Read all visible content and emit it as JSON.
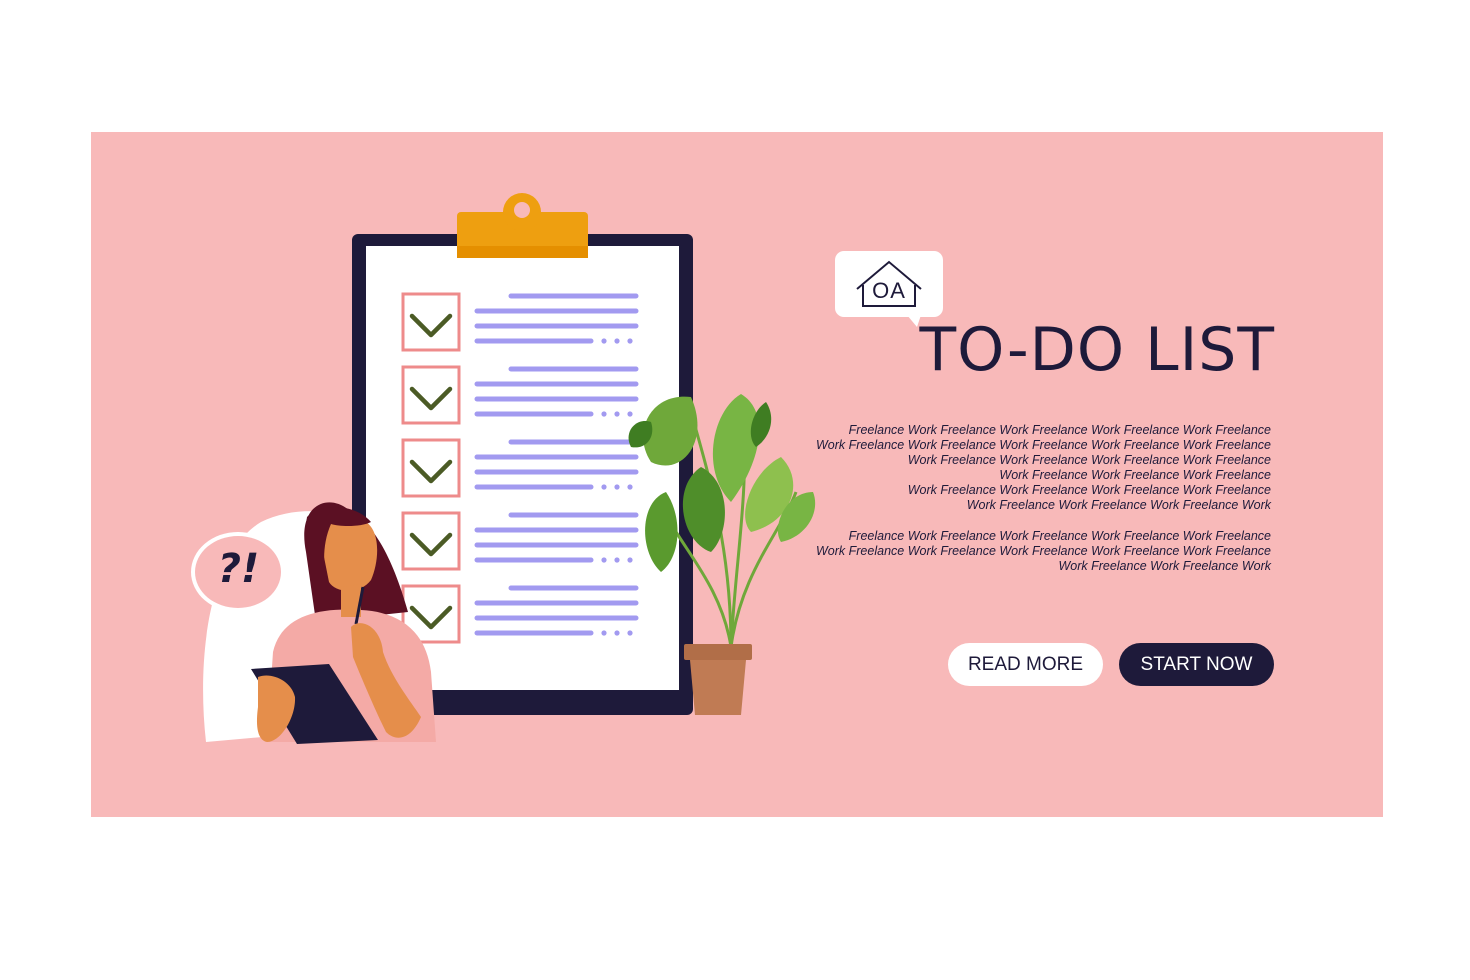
{
  "hero": {
    "logo_text": "OA",
    "title": "TO-DO LIST",
    "paragraph_1": [
      "Freelance Work Freelance Work Freelance Work Freelance Work Freelance",
      "Work Freelance Work Freelance Work Freelance Work Freelance Work Freelance",
      "Work Freelance Work Freelance Work Freelance Work Freelance",
      "Work Freelance Work Freelance Work Freelance",
      "Work Freelance Work Freelance Work Freelance Work Freelance",
      "Work Freelance Work Freelance Work Freelance Work"
    ],
    "paragraph_2": [
      "Freelance Work Freelance Work Freelance Work Freelance Work Freelance",
      "Work Freelance Work Freelance Work Freelance Work Freelance Work Freelance",
      "Work Freelance Work Freelance Work"
    ],
    "read_more_label": "READ MORE",
    "start_now_label": "START NOW",
    "question_bubble_text": "?!"
  },
  "checklist": {
    "items": [
      {
        "checked": true
      },
      {
        "checked": true
      },
      {
        "checked": true
      },
      {
        "checked": true
      },
      {
        "checked": true
      }
    ]
  },
  "icons": [
    "house-logo-icon",
    "clipboard-icon",
    "checkmark-icon",
    "plant-icon",
    "woman-figure",
    "tablet-icon",
    "question-bubble-icon"
  ],
  "colors": {
    "banner_bg": "#f8b9b9",
    "navy": "#1e1a3a",
    "clip": "#ee9f10",
    "list_line": "#a29af0",
    "check_box": "#ee8b8b",
    "check_mark": "#4b5b25",
    "leaf": "#6fa83a",
    "pot": "#c07b54"
  }
}
